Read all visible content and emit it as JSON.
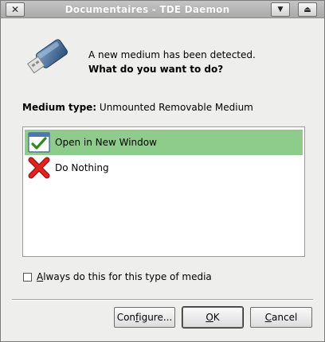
{
  "window": {
    "title": "Documentaires - TDE Daemon"
  },
  "header": {
    "message": "A new medium has been detected.",
    "question": "What do you want to do?"
  },
  "medium": {
    "label": "Medium type:",
    "value": "Unmounted Removable Medium"
  },
  "actions": [
    {
      "label": "Open in New Window",
      "icon": "window-check-icon",
      "selected": true
    },
    {
      "label": "Do Nothing",
      "icon": "red-x-icon",
      "selected": false
    }
  ],
  "remember": {
    "label_prefix": "A",
    "label_rest": "lways do this for this type of media",
    "checked": false
  },
  "buttons": {
    "configure_prefix": "Con",
    "configure_u": "f",
    "configure_rest": "igure...",
    "ok_u": "O",
    "ok_rest": "K",
    "cancel_u": "C",
    "cancel_rest": "ancel"
  },
  "colors": {
    "selection": "#8dcc8a",
    "titlebar": "#b0b0b0"
  }
}
